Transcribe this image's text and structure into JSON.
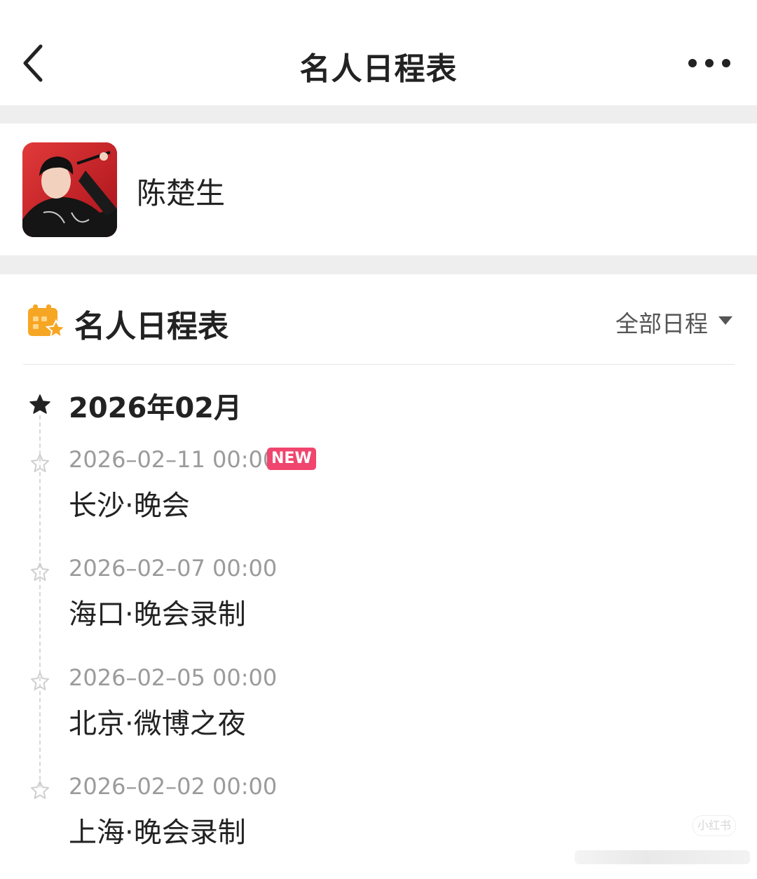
{
  "nav": {
    "title": "名人日程表"
  },
  "profile": {
    "name": "陈楚生"
  },
  "section": {
    "title": "名人日程表",
    "filter_label": "全部日程"
  },
  "month": "2026年02月",
  "events": [
    {
      "datetime": "2026–02–11 00:00",
      "badge": "NEW",
      "title": "长沙·晚会"
    },
    {
      "datetime": "2026–02–07 00:00",
      "title": "海口·晚会录制"
    },
    {
      "datetime": "2026–02–05 00:00",
      "title": "北京·微博之夜"
    },
    {
      "datetime": "2026–02–02 00:00",
      "title": "上海·晚会录制"
    }
  ],
  "watermark": "小红书",
  "colors": {
    "accent_orange": "#f6a623",
    "badge_pink": "#f0456e",
    "muted_text": "#9b9b9b"
  }
}
